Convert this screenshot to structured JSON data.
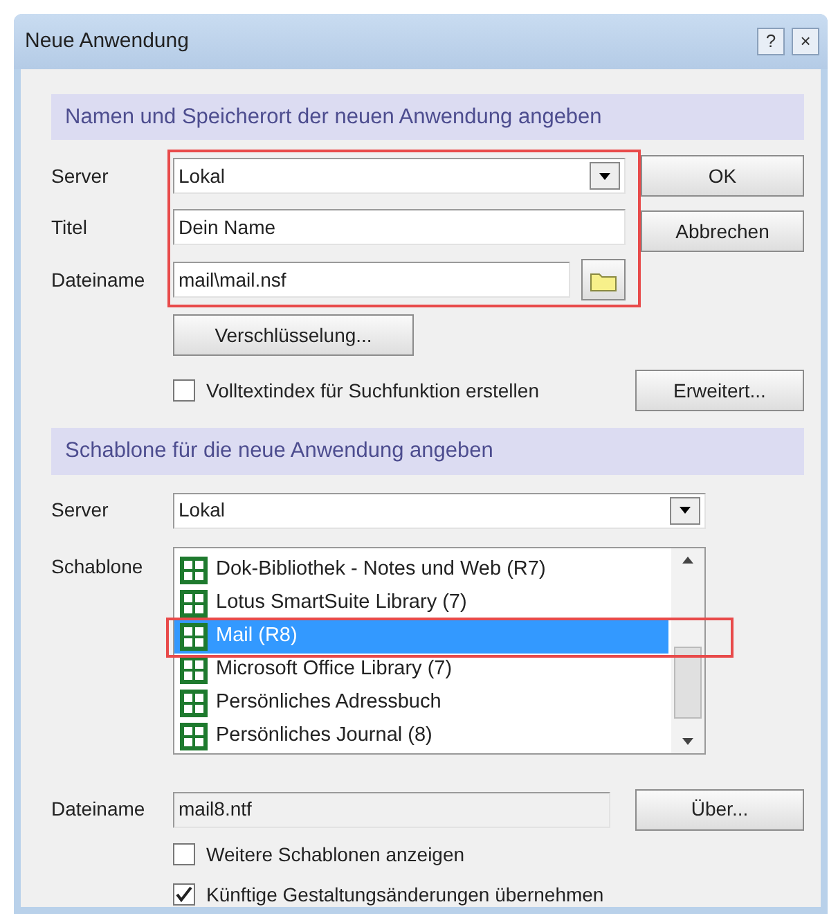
{
  "window": {
    "title": "Neue Anwendung",
    "help_button": "?",
    "close_button": "×"
  },
  "section_1": {
    "heading": "Namen und Speicherort der neuen Anwendung angeben",
    "server": {
      "label": "Server",
      "value": "Lokal"
    },
    "title": {
      "label": "Titel",
      "value": "Dein Name"
    },
    "filename": {
      "label": "Dateiname",
      "value": "mail\\mail.nsf"
    },
    "encryption_button": "Verschlüsselung...",
    "fulltext_index": {
      "label": "Volltextindex für Suchfunktion erstellen",
      "checked": false
    },
    "buttons": [
      "OK",
      "Abbrechen",
      "Erweitert..."
    ]
  },
  "section_2": {
    "heading": "Schablone für die neue Anwendung angeben",
    "server": {
      "label": "Server",
      "value": "Lokal"
    },
    "template_label": "Schablone",
    "templates": [
      {
        "name": "Dok-Bibliothek - Notes und Web (R7)",
        "selected": false
      },
      {
        "name": "Lotus SmartSuite Library (7)",
        "selected": false
      },
      {
        "name": "Mail (R8)",
        "selected": true
      },
      {
        "name": "Microsoft Office Library (7)",
        "selected": false
      },
      {
        "name": "Persönliches Adressbuch",
        "selected": false
      },
      {
        "name": "Persönliches Journal (8)",
        "selected": false
      }
    ],
    "filename": {
      "label": "Dateiname",
      "value": "mail8.ntf"
    },
    "about_button": "Über...",
    "options": [
      {
        "label": "Weitere Schablonen anzeigen",
        "checked": false
      },
      {
        "label": "Künftige Gestaltungsänderungen übernehmen",
        "checked": true
      }
    ]
  }
}
